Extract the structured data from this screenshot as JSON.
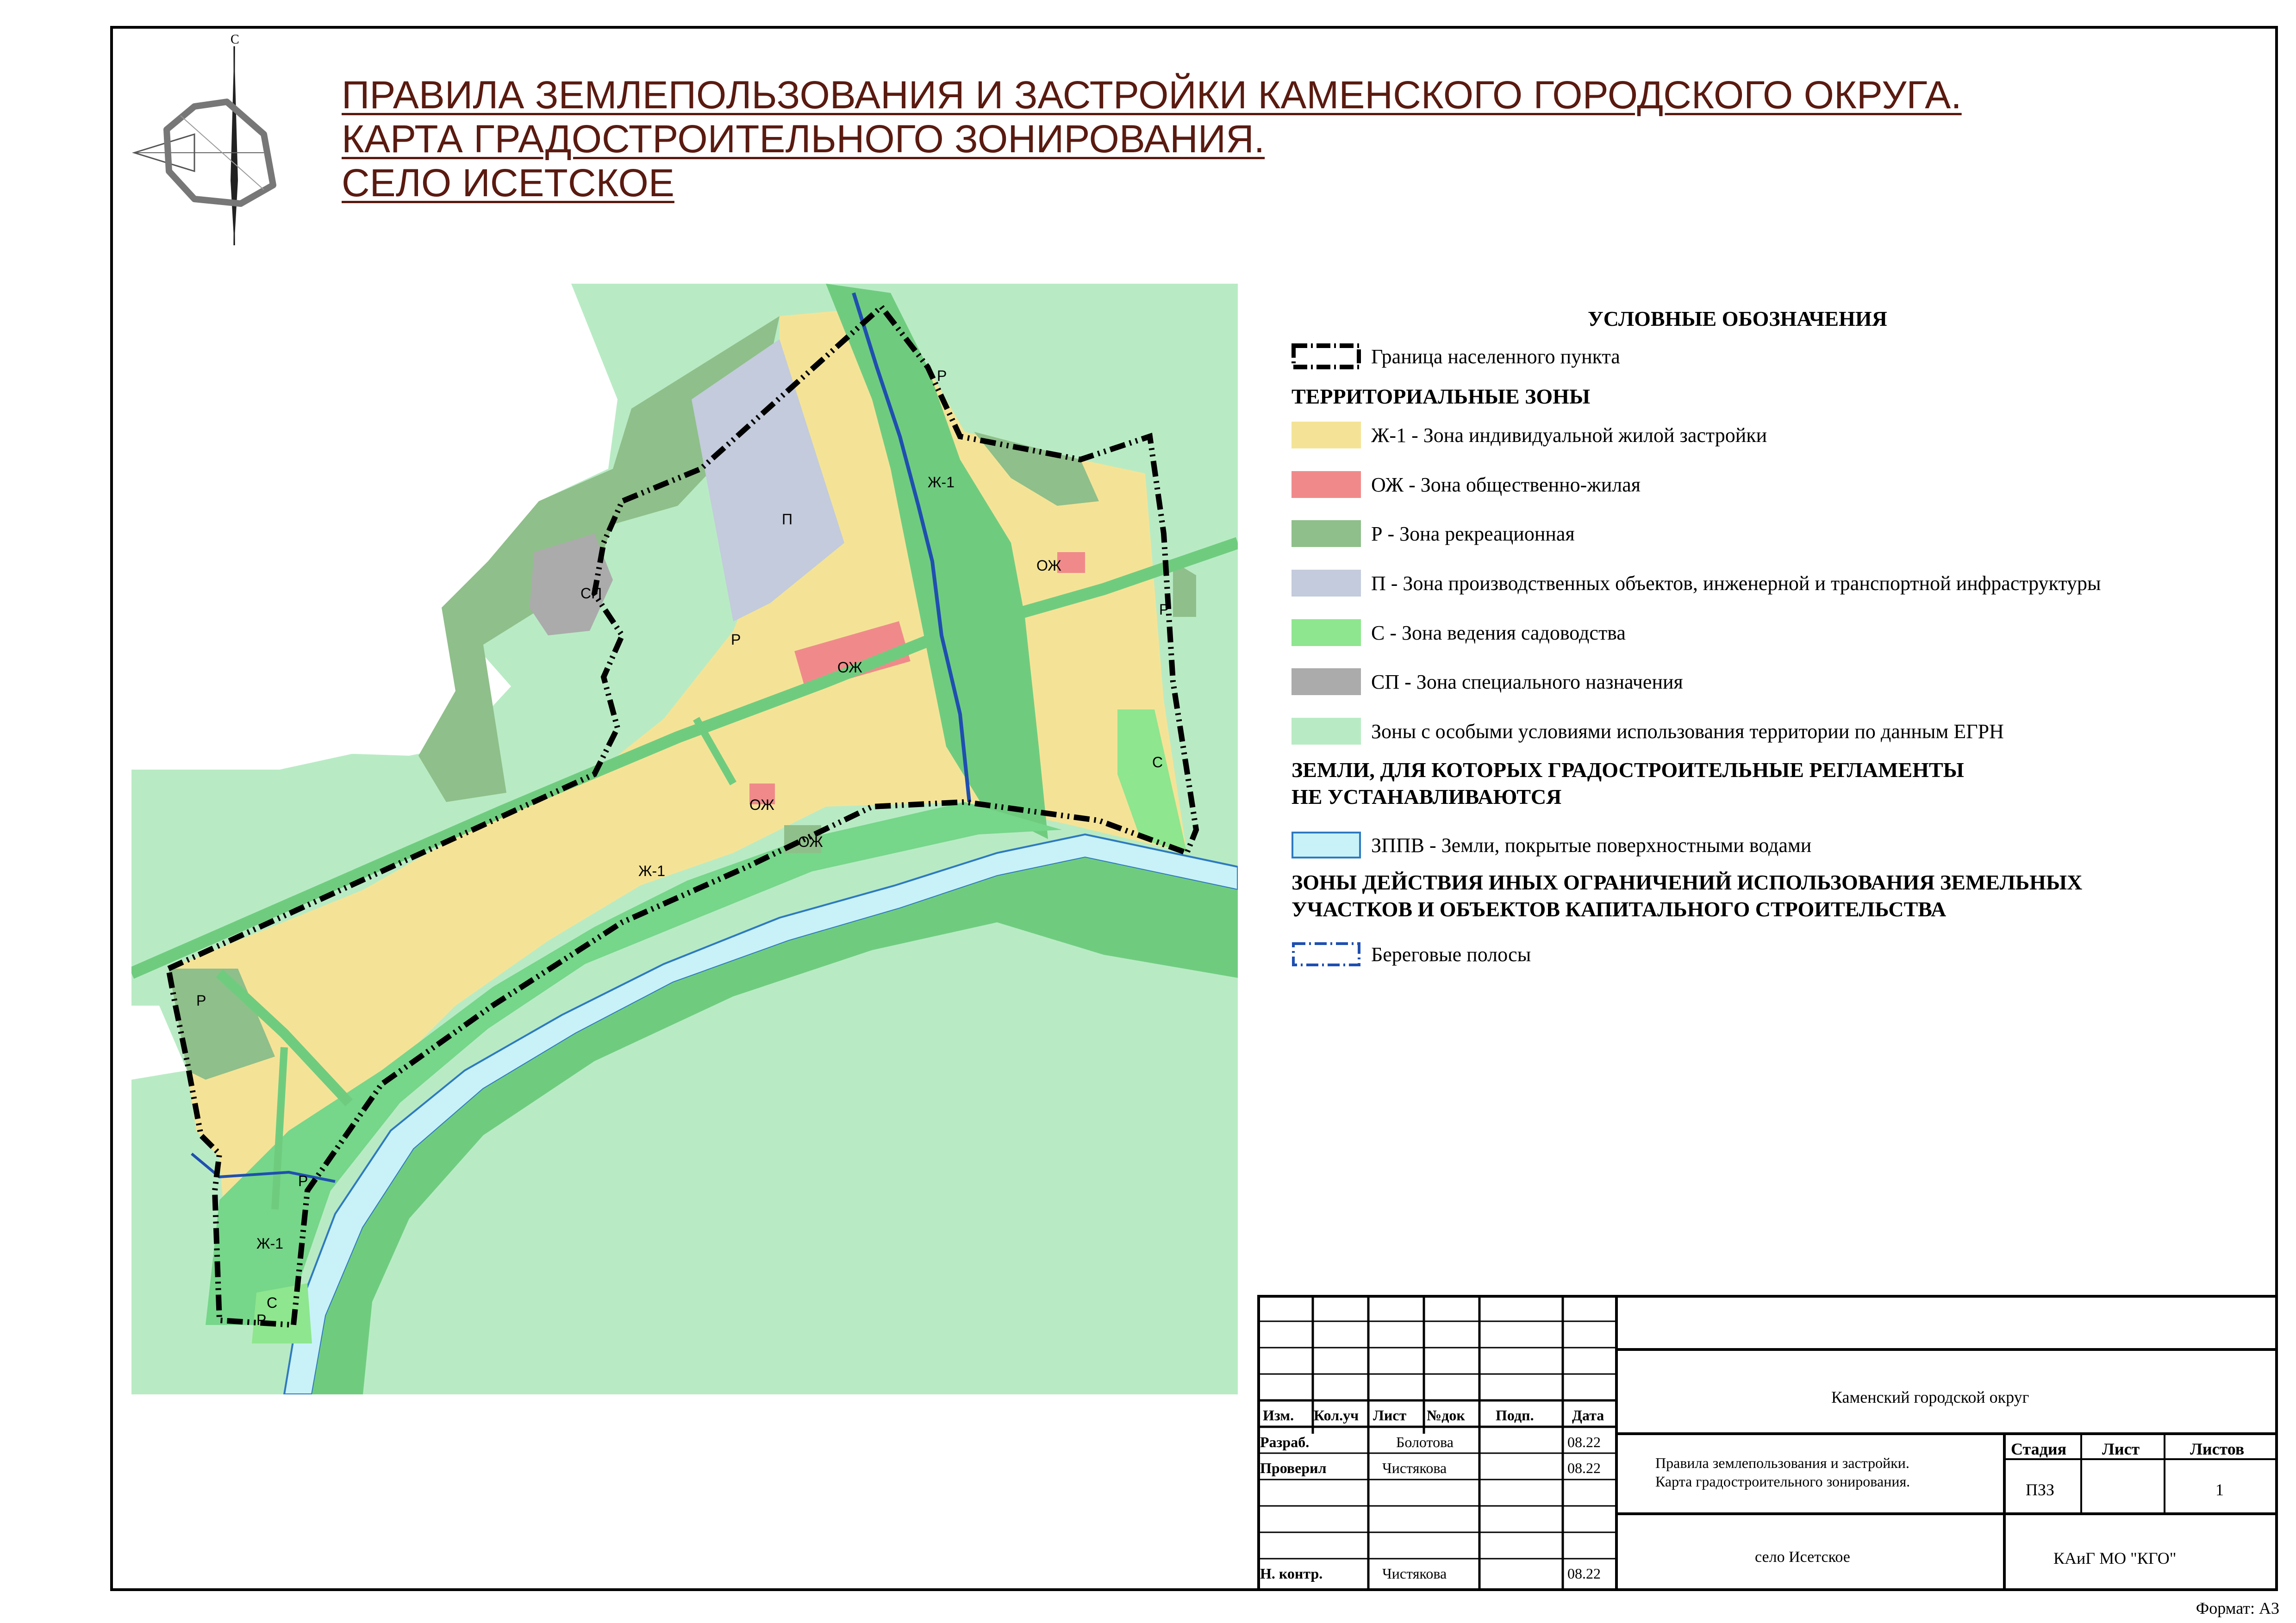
{
  "title": {
    "line1": "ПРАВИЛА ЗЕМЛЕПОЛЬЗОВАНИЯ И ЗАСТРОЙКИ КАМЕНСКОГО ГОРОДСКОГО ОКРУГА.",
    "line2": "КАРТА ГРАДОСТРОИТЕЛЬНОГО ЗОНИРОВАНИЯ.",
    "line3": "СЕЛО ИСЕТСКОЕ"
  },
  "north_arrow": {
    "label": "С",
    "icon": "north-arrow-icon"
  },
  "map_labels": {
    "p_industrial": "П",
    "r_1": "Р",
    "r_2": "Р",
    "r_3": "Р",
    "r_4": "Р",
    "r_5": "Р",
    "r_6": "Р",
    "sp": "СП",
    "oj_1": "ОЖ",
    "oj_2": "ОЖ",
    "oj_3": "ОЖ",
    "oj_4": "ОЖ",
    "zh1_1": "Ж-1",
    "zh1_2": "Ж-1",
    "zh1_3": "Ж-1",
    "s_1": "С",
    "s_2": "С"
  },
  "legend": {
    "heading": "УСЛОВНЫЕ ОБОЗНАЧЕНИЯ",
    "boundary": "Граница населенного пункта",
    "zones_heading": "ТЕРРИТОРИАЛЬНЫЕ ЗОНЫ",
    "zones": [
      {
        "label": "Ж-1 - Зона индивидуальной жилой застройки",
        "color": "#f4e397"
      },
      {
        "label": "ОЖ - Зона общественно-жилая",
        "color": "#f08a8a"
      },
      {
        "label": "Р - Зона рекреационная",
        "color": "#8fbf8a"
      },
      {
        "label": "П - Зона производственных объектов, инженерной и транспортной инфраструктуры",
        "color": "#c3cbdc"
      },
      {
        "label": "С - Зона ведения садоводства",
        "color": "#8ee68e"
      },
      {
        "label": "СП - Зона специального назначения",
        "color": "#ababab"
      },
      {
        "label": "Зоны с особыми условиями использования территории по данным ЕГРН",
        "color": "#b8ebc4"
      }
    ],
    "no_regs_heading_1": "ЗЕМЛИ, ДЛЯ КОТОРЫХ ГРАДОСТРОИТЕЛЬНЫЕ РЕГЛАМЕНТЫ",
    "no_regs_heading_2": "НЕ УСТАНАВЛИВАЮТСЯ",
    "water": {
      "label": "ЗППВ - Земли, покрытые поверхностными водами",
      "color": "#c8f2f8"
    },
    "restrictions_heading_1": "ЗОНЫ ДЕЙСТВИЯ ИНЫХ ОГРАНИЧЕНИЙ ИСПОЛЬЗОВАНИЯ ЗЕМЕЛЬНЫХ",
    "restrictions_heading_2": "УЧАСТКОВ И ОБЪЕКТОВ КАПИТАЛЬНОГО СТРОИТЕЛЬСТВА",
    "shore": "Береговые полосы"
  },
  "stamp": {
    "col_headers": [
      "Изм.",
      "Кол.уч",
      "Лист",
      "№док",
      "Подп.",
      "Дата"
    ],
    "rows": [
      {
        "role": "Разраб.",
        "name": "Болотова",
        "date": "08.22"
      },
      {
        "role": "Проверил",
        "name": "Чистякова",
        "date": "08.22"
      },
      {
        "role": "Н. контр.",
        "name": "Чистякова",
        "date": "08.22"
      }
    ],
    "organization_top": "Каменский городской округ",
    "doc_title_1": "Правила землепользования и застройки.",
    "doc_title_2": "Карта градостроительного зонирования.",
    "stage_header": "Стадия",
    "sheet_header": "Лист",
    "sheets_header": "Листов",
    "stage_value": "ПЗЗ",
    "sheets_value": "1",
    "place": "село Исетское",
    "company": "КАиГ МО \"КГО\""
  },
  "format": "Формат: А3"
}
